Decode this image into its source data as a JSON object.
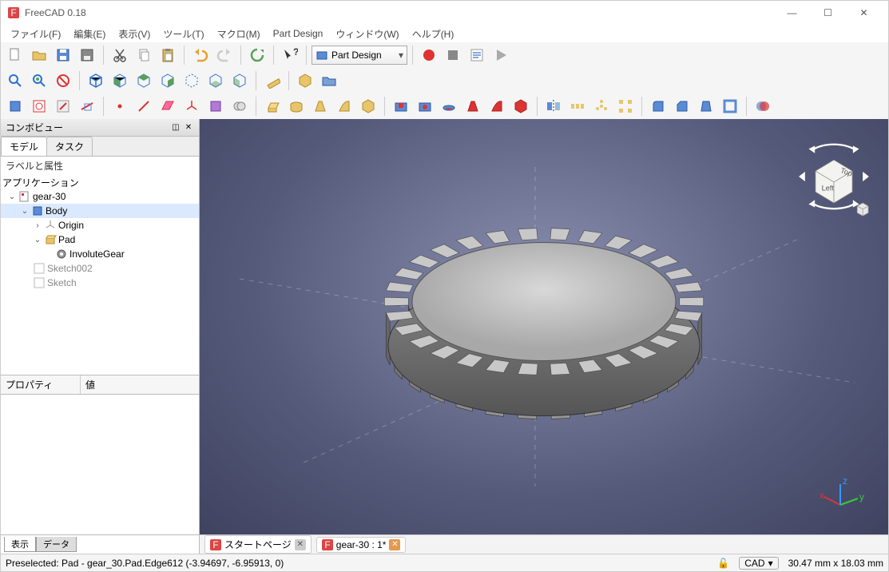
{
  "app": {
    "title": "FreeCAD 0.18"
  },
  "window_controls": {
    "min": "—",
    "max": "☐",
    "close": "✕"
  },
  "menu": [
    "ファイル(F)",
    "編集(E)",
    "表示(V)",
    "ツール(T)",
    "マクロ(M)",
    "Part Design",
    "ウィンドウ(W)",
    "ヘルプ(H)"
  ],
  "workbench": {
    "label": "Part Design"
  },
  "combo": {
    "title": "コンボビュー",
    "tabs": {
      "model": "モデル",
      "task": "タスク"
    },
    "labels_attrs": "ラベルと属性",
    "application": "アプリケーション",
    "tree": {
      "root": "gear-30",
      "body": "Body",
      "origin": "Origin",
      "pad": "Pad",
      "involute": "InvoluteGear",
      "sketch002": "Sketch002",
      "sketch": "Sketch"
    },
    "property_header": {
      "prop": "プロパティ",
      "value": "値"
    },
    "bottom_tabs": {
      "view": "表示",
      "data": "データ"
    }
  },
  "doc_tabs": {
    "start": "スタートページ",
    "doc": "gear-30 : 1*"
  },
  "navcube": {
    "face1": "Top",
    "face2": "Left"
  },
  "axes": {
    "x": "x",
    "y": "y",
    "z": "z"
  },
  "status": {
    "preselect": "Preselected: Pad - gear_30.Pad.Edge612 (-3.94697, -6.95913, 0)",
    "mode": "CAD",
    "dims": "30.47 mm x 18.03 mm"
  },
  "icons": {
    "min": "—",
    "max": "☐",
    "close": "✕",
    "dropdown": "▾",
    "pin": "◫",
    "x": "✕",
    "caret_down": "▾",
    "caret_right": "▸"
  }
}
